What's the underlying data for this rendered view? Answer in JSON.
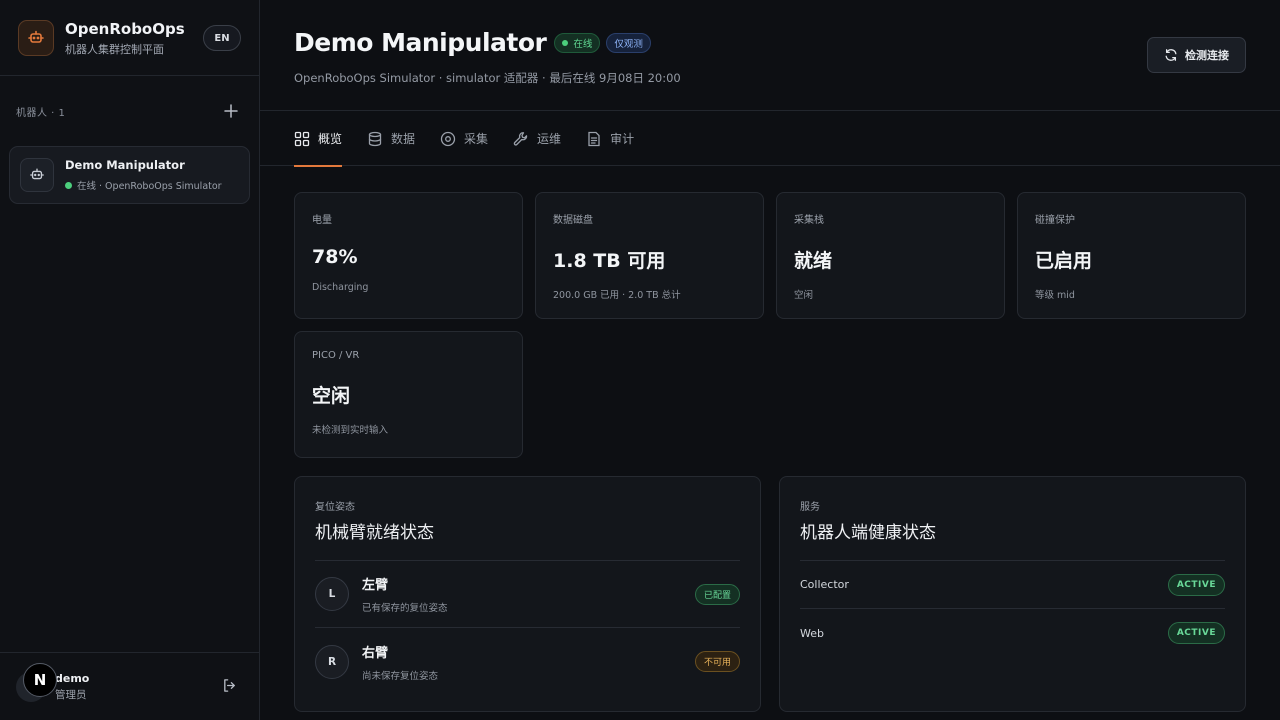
{
  "brand": {
    "title": "OpenRoboOps",
    "subtitle": "机器人集群控制平面",
    "lang": "EN"
  },
  "sidebar": {
    "section_label": "机器人 · 1",
    "robots": [
      {
        "name": "Demo Manipulator",
        "status": "在线 · OpenRoboOps Simulator"
      }
    ]
  },
  "user": {
    "badge": "N",
    "name": "demo",
    "role": "管理员"
  },
  "header": {
    "title": "Demo Manipulator",
    "status_badge": "在线",
    "mode_badge": "仅观测",
    "subtitle": "OpenRoboOps Simulator · simulator 适配器 · 最后在线 9月08日 20:00",
    "check_button": "检测连接"
  },
  "tabs": [
    {
      "label": "概览",
      "icon": "grid-icon",
      "active": true
    },
    {
      "label": "数据",
      "icon": "database-icon"
    },
    {
      "label": "采集",
      "icon": "record-icon"
    },
    {
      "label": "运维",
      "icon": "wrench-icon"
    },
    {
      "label": "审计",
      "icon": "document-icon"
    }
  ],
  "stats": [
    {
      "label": "电量",
      "value": "78%",
      "sub": "Discharging"
    },
    {
      "label": "数据磁盘",
      "value": "1.8 TB 可用",
      "sub": "200.0 GB 已用 · 2.0 TB 总计"
    },
    {
      "label": "采集栈",
      "value": "就绪",
      "sub": "空闲"
    },
    {
      "label": "碰撞保护",
      "value": "已启用",
      "sub": "等级 mid"
    },
    {
      "label": "PICO / VR",
      "value": "空闲",
      "sub": "未检测到实时输入"
    }
  ],
  "arms_panel": {
    "kicker": "复位姿态",
    "title": "机械臂就绪状态",
    "arms": [
      {
        "letter": "L",
        "name": "左臂",
        "desc": "已有保存的复位姿态",
        "status": "已配置"
      },
      {
        "letter": "R",
        "name": "右臂",
        "desc": "尚未保存复位姿态",
        "status": "不可用"
      }
    ]
  },
  "services_panel": {
    "kicker": "服务",
    "title": "机器人端健康状态",
    "services": [
      {
        "name": "Collector",
        "status": "ACTIVE"
      },
      {
        "name": "Web",
        "status": "ACTIVE"
      }
    ]
  },
  "colors": {
    "accent": "#e3793c",
    "success": "#61d992",
    "warning": "#e9b35b",
    "info": "#8cb1f4"
  }
}
